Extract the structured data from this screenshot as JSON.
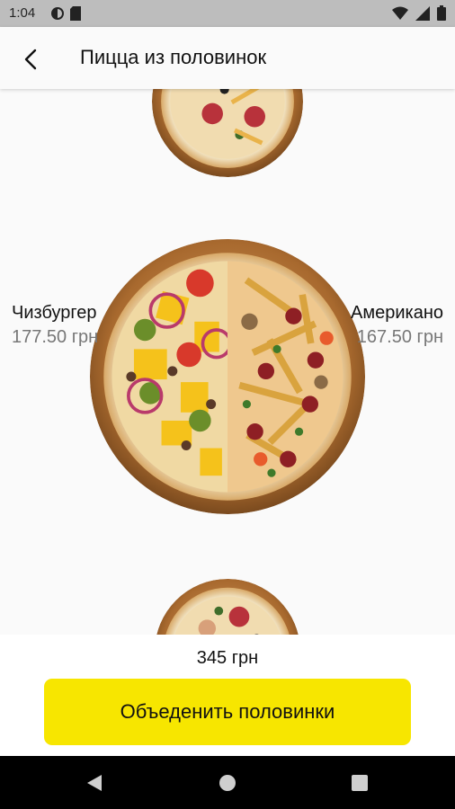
{
  "status_bar": {
    "time": "1:04",
    "icons": [
      "data-saver-icon",
      "sd-card-icon",
      "wifi-icon",
      "signal-icon",
      "battery-icon"
    ]
  },
  "app_bar": {
    "title": "Пицца из половинок",
    "back_icon": "chevron-left-icon"
  },
  "halves": {
    "left": {
      "name": "Чизбургер",
      "price": "177.50 грн"
    },
    "right": {
      "name": "Американо",
      "price": "167.50 грн"
    }
  },
  "bottom": {
    "total": "345 грн",
    "combine_label": "Объеденить половинки",
    "button_color": "#f7e600"
  },
  "nav_bar": {
    "icons": [
      "back-triangle-icon",
      "home-circle-icon",
      "recents-square-icon"
    ]
  }
}
